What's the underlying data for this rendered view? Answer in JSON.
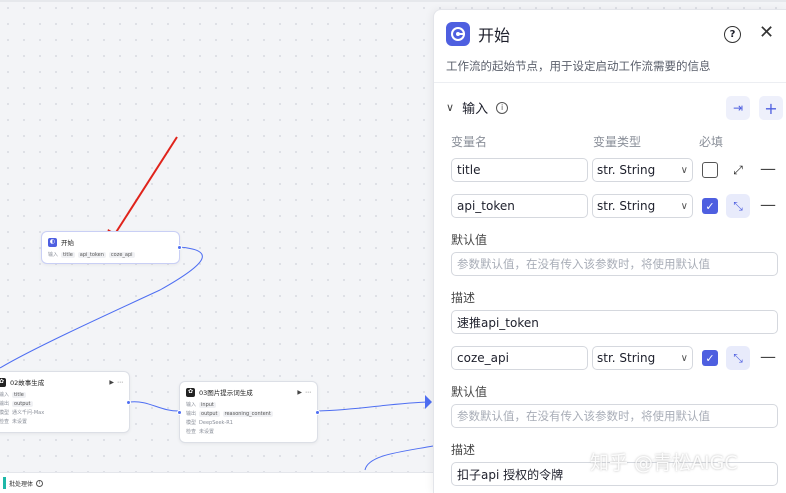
{
  "canvas": {
    "start_node": {
      "title": "开始",
      "label": "输入",
      "tags": [
        "title",
        "api_token",
        "coze_api"
      ]
    },
    "node_story": {
      "title": "02故事生成",
      "rows": [
        [
          "输入",
          "title"
        ],
        [
          "输出",
          "output"
        ],
        [
          "模型",
          "通义千问-Max"
        ],
        [
          "检查",
          "未设置"
        ]
      ]
    },
    "node_image": {
      "title": "03图片提示词生成",
      "rows": [
        [
          "输入",
          "input"
        ],
        [
          "输出",
          "output",
          "reasoning_content"
        ],
        [
          "模型",
          "DeepSeek-R1"
        ],
        [
          "检查",
          "未设置"
        ]
      ]
    },
    "bottom_label": "批处理体"
  },
  "panel": {
    "title": "开始",
    "description": "工作流的起始节点，用于设定启动工作流需要的信息",
    "section_title": "输入",
    "columns": {
      "name": "变量名",
      "type": "变量类型",
      "required": "必填"
    },
    "variables": [
      {
        "name": "title",
        "type": "str. String",
        "required": false
      },
      {
        "name": "api_token",
        "type": "str. String",
        "required": true,
        "default_label": "默认值",
        "default_placeholder": "参数默认值，在没有传入该参数时，将使用默认值",
        "desc_label": "描述",
        "desc_value": "速推api_token"
      },
      {
        "name": "coze_api",
        "type": "str. String",
        "required": true,
        "default_label": "默认值",
        "default_placeholder": "参数默认值，在没有传入该参数时，将使用默认值",
        "desc_label": "描述",
        "desc_value": "扣子api 授权的令牌"
      }
    ]
  },
  "watermark": "知乎 @青松AIGC",
  "colors": {
    "accent": "#4e5fe0",
    "arrow": "#e0231b",
    "edge": "#4e6ef2"
  }
}
